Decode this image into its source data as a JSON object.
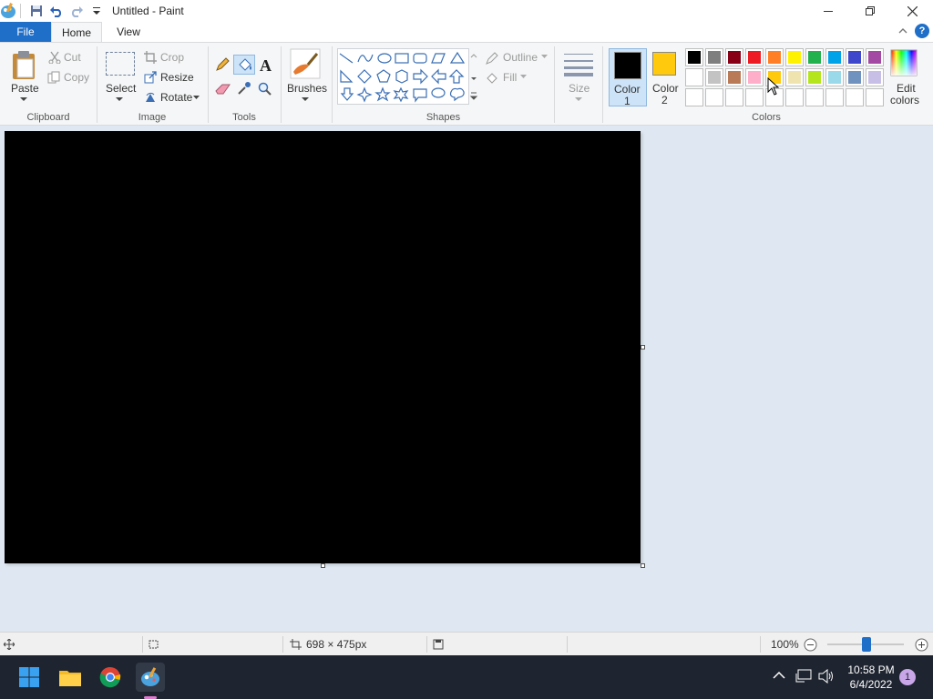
{
  "window": {
    "title": "Untitled - Paint"
  },
  "tabs": [
    {
      "label": "File"
    },
    {
      "label": "Home"
    },
    {
      "label": "View"
    }
  ],
  "ribbon": {
    "clipboard": {
      "group": "Clipboard",
      "paste": "Paste",
      "cut": "Cut",
      "copy": "Copy"
    },
    "image": {
      "group": "Image",
      "select": "Select",
      "crop": "Crop",
      "resize": "Resize",
      "rotate": "Rotate"
    },
    "tools": {
      "group": "Tools"
    },
    "brushes": {
      "label": "Brushes"
    },
    "shapes": {
      "group": "Shapes",
      "outline": "Outline",
      "fill": "Fill"
    },
    "size": {
      "label": "Size"
    },
    "colors": {
      "group": "Colors",
      "color1_label_a": "Color",
      "color1_label_b": "1",
      "color2_label_a": "Color",
      "color2_label_b": "2",
      "edit_a": "Edit",
      "edit_b": "colors",
      "color1": "#000000",
      "color2": "#ffc90e",
      "palette_row1": [
        "#000000",
        "#7f7f7f",
        "#880015",
        "#ed1c24",
        "#ff7f27",
        "#fff200",
        "#22b14c",
        "#00a2e8",
        "#3f48cc",
        "#a349a4"
      ],
      "palette_row2": [
        "#ffffff",
        "#c3c3c3",
        "#b97a57",
        "#ffaec9",
        "#ffc90e",
        "#efe4b0",
        "#b5e61d",
        "#99d9ea",
        "#7092be",
        "#c8bfe7"
      ],
      "palette_row3": [
        "#ffffff",
        "#ffffff",
        "#ffffff",
        "#ffffff",
        "#ffffff",
        "#ffffff",
        "#ffffff",
        "#ffffff",
        "#ffffff",
        "#ffffff"
      ]
    }
  },
  "canvas": {
    "fill": "#000000"
  },
  "status": {
    "dimensions": "698 × 475px",
    "zoom": "100%"
  },
  "taskbar": {
    "time": "10:58 PM",
    "date": "6/4/2022",
    "notifications": "1",
    "apps": [
      "start-icon",
      "file-explorer-icon",
      "chrome-icon",
      "paint-icon"
    ]
  }
}
